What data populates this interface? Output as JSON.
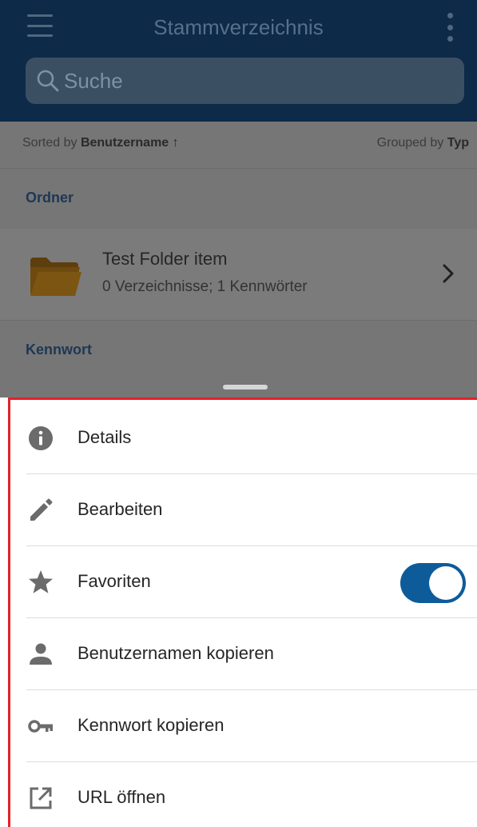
{
  "header": {
    "title": "Stammverzeichnis",
    "menu_icon": "hamburger-menu-icon",
    "more_icon": "vertical-dots-icon",
    "background_color": "#0d2a48"
  },
  "search": {
    "placeholder": "Suche",
    "value": ""
  },
  "sort_bar": {
    "sorted_prefix": "Sorted by ",
    "sorted_field": "Benutzername ↑",
    "grouped_prefix": "Grouped by ",
    "grouped_field": "Typ"
  },
  "sections": {
    "folders_header": "Ordner",
    "passwords_header": "Kennwort"
  },
  "folder_item": {
    "name": "Test Folder item",
    "meta": "0 Verzeichnisse; 1 Kennwörter",
    "icon": "folder-icon"
  },
  "action_sheet": {
    "highlight_color": "#e3222a",
    "items": [
      {
        "label": "Details",
        "icon": "info-icon"
      },
      {
        "label": "Bearbeiten",
        "icon": "pencil-icon"
      },
      {
        "label": "Favoriten",
        "icon": "star-icon",
        "toggle_on": true
      },
      {
        "label": "Benutzernamen kopieren",
        "icon": "person-icon"
      },
      {
        "label": "Kennwort kopieren",
        "icon": "key-icon"
      },
      {
        "label": "URL öffnen",
        "icon": "open-external-icon"
      }
    ]
  },
  "colors": {
    "accent": "#0e5b9a",
    "section_header_text": "#1e3754"
  }
}
